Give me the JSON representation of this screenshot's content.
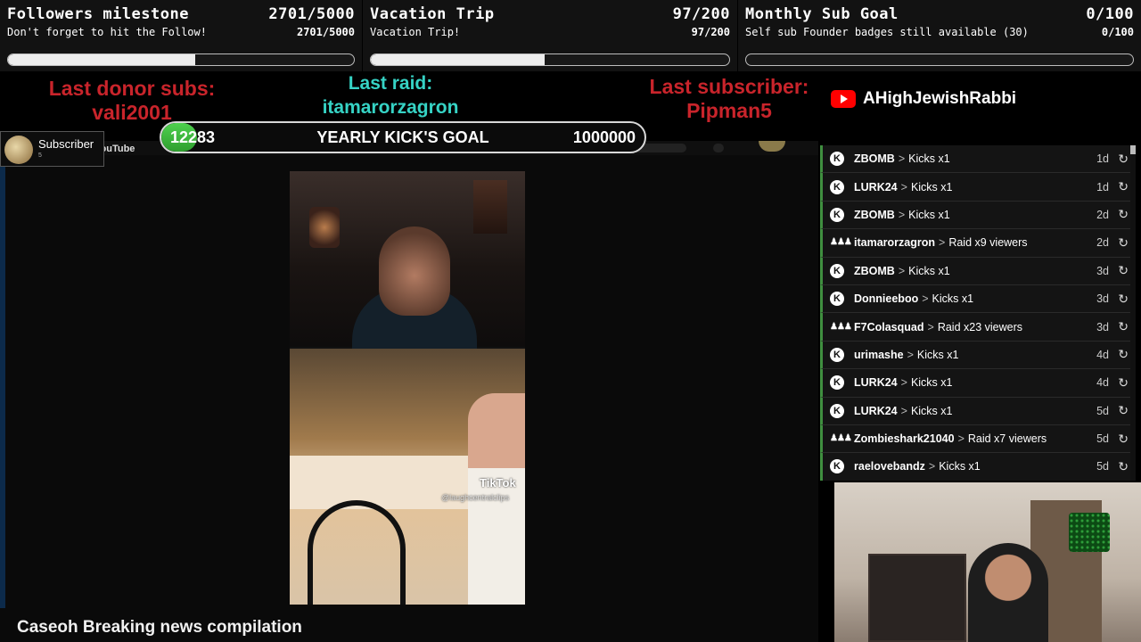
{
  "goals": [
    {
      "title": "Followers milestone",
      "count": "2701/5000",
      "subtitle": "Don't forget to hit the Follow!",
      "count2": "2701/5000",
      "progress": 0.5402
    },
    {
      "title": "Vacation Trip",
      "count": "97/200",
      "subtitle": "Vacation Trip!",
      "count2": "97/200",
      "progress": 0.485
    },
    {
      "title": "Monthly Sub Goal",
      "count": "0/100",
      "subtitle": "Self sub Founder badges still available (30)",
      "count2": "0/100",
      "progress": 0
    }
  ],
  "last_donor": {
    "label": "Last donor subs:",
    "name": "vali2001"
  },
  "last_raid": {
    "label": "Last raid:",
    "name": "itamarorzagron"
  },
  "last_subscriber": {
    "label": "Last subscriber:",
    "name": "Pipman5"
  },
  "youtube_channel": "AHighJewishRabbi",
  "yearly_goal": {
    "current": "12283",
    "title": "YEARLY KICK'S GOAL",
    "max": "1000000",
    "progress": 0.012283
  },
  "subscriber_badge": {
    "label": "Subscriber",
    "count": "5"
  },
  "youtube_bar": {
    "logo_text": "YouTube"
  },
  "video": {
    "tiktok_label": "TikTok",
    "tiktok_handle": "@laughcentralclips"
  },
  "video_title": "Caseoh Breaking news compilation",
  "events": [
    {
      "user": "ZBOMB",
      "action": "Kicks x1",
      "age": "1d",
      "type": "kick"
    },
    {
      "user": "LURK24",
      "action": "Kicks x1",
      "age": "1d",
      "type": "kick"
    },
    {
      "user": "ZBOMB",
      "action": "Kicks x1",
      "age": "2d",
      "type": "kick"
    },
    {
      "user": "itamarorzagron",
      "action": "Raid x9 viewers",
      "age": "2d",
      "type": "raid"
    },
    {
      "user": "ZBOMB",
      "action": "Kicks x1",
      "age": "3d",
      "type": "kick"
    },
    {
      "user": "Donnieeboo",
      "action": "Kicks x1",
      "age": "3d",
      "type": "kick"
    },
    {
      "user": "F7Colasquad",
      "action": "Raid x23 viewers",
      "age": "3d",
      "type": "raid"
    },
    {
      "user": "urimashe",
      "action": "Kicks x1",
      "age": "4d",
      "type": "kick"
    },
    {
      "user": "LURK24",
      "action": "Kicks x1",
      "age": "4d",
      "type": "kick"
    },
    {
      "user": "LURK24",
      "action": "Kicks x1",
      "age": "5d",
      "type": "kick"
    },
    {
      "user": "Zombieshark21040",
      "action": "Raid x7 viewers",
      "age": "5d",
      "type": "raid"
    },
    {
      "user": "raelovebandz",
      "action": "Kicks x1",
      "age": "5d",
      "type": "kick"
    }
  ],
  "icons": {
    "kick": "kick-icon",
    "raid": "raid-icon",
    "replay": "replay-icon",
    "separator": ">"
  },
  "colors": {
    "accent_red": "#c9242b",
    "accent_cyan": "#36d3c5",
    "goal_green": "#3fb63f"
  }
}
